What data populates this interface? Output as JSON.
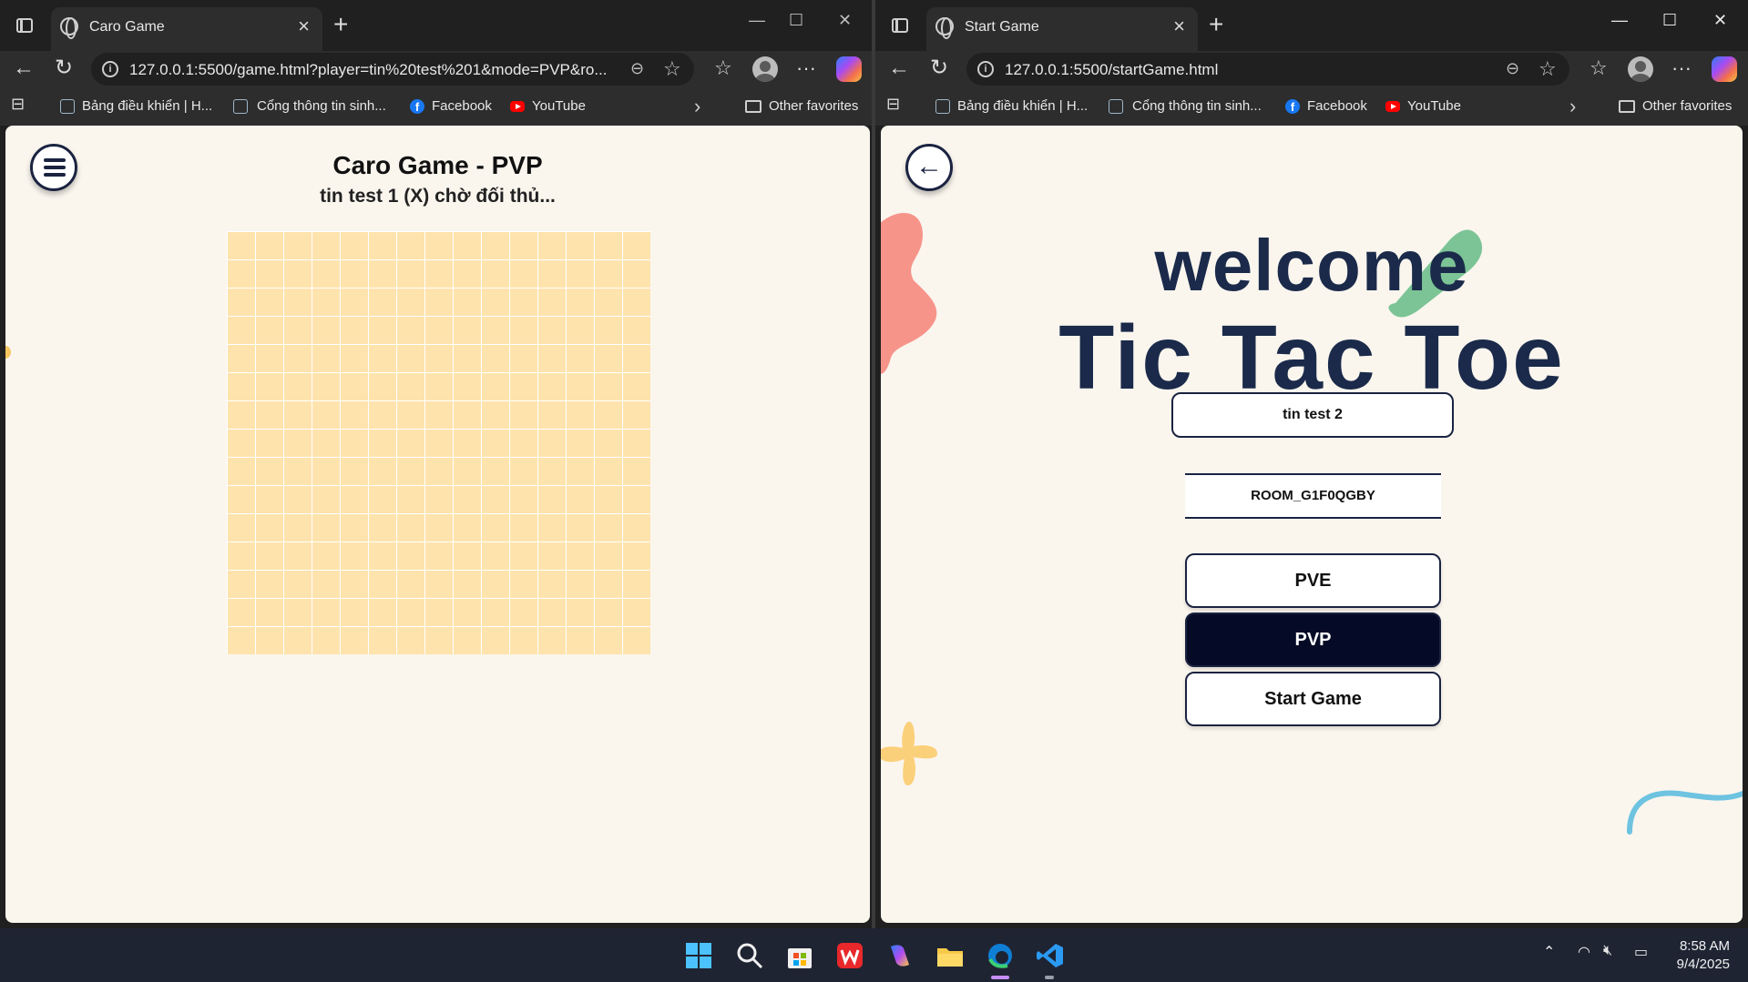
{
  "left_window": {
    "tab_title": "Caro Game",
    "url": "127.0.0.1:5500/game.html?player=tin%20test%201&mode=PVP&ro...",
    "page": {
      "title": "Caro Game - PVP",
      "status": "tin test 1 (X) chờ đối thủ..."
    }
  },
  "right_window": {
    "tab_title": "Start Game",
    "url": "127.0.0.1:5500/startGame.html",
    "page": {
      "welcome": "welcome",
      "heading": "Tic Tac Toe",
      "player_name": "tin test 2",
      "room_id": "ROOM_G1F0QGBY",
      "buttons": {
        "pve": "PVE",
        "pvp": "PVP",
        "start": "Start Game"
      },
      "selected_mode": "PVP"
    }
  },
  "bookmarks": {
    "items": [
      {
        "label": "Bảng điều khiển | H...",
        "icon": "site-icon"
      },
      {
        "label": "Cổng thông tin sinh...",
        "icon": "site-icon"
      },
      {
        "label": "Facebook",
        "icon": "facebook-icon"
      },
      {
        "label": "YouTube",
        "icon": "youtube-icon"
      }
    ],
    "other": "Other favorites"
  },
  "taskbar": {
    "time": "8:58 AM",
    "date": "9/4/2025"
  },
  "colors": {
    "page_bg": "#faf6ee",
    "board": "#ffe3ad",
    "navy": "#1b2a4a",
    "active_button": "#050a26"
  }
}
